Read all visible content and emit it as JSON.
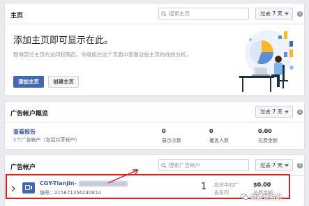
{
  "pages_card": {
    "title": "主页",
    "search_placeholder": "搜索主页",
    "range": "过去 7 天",
    "heading": "添加主页即可显示在此。",
    "description": "取得部分主页的访问权限后，你就能在这个页面中查看这些主页的成效分析。",
    "add_button": "添加主页",
    "create_button": "创建主页"
  },
  "ad_overview": {
    "title": "广告帐户概览",
    "range": "过去 7 天",
    "report_link": "查看报告",
    "account_count": "1个广告帐户（包括共享帐户）",
    "stats": [
      {
        "value": "0",
        "label": "展示次数"
      },
      {
        "value": "0",
        "label": "覆盖人数"
      },
      {
        "value": "0.00",
        "label": "花费金额"
      }
    ]
  },
  "ad_accounts": {
    "title": "广告帐户",
    "search_placeholder": "搜索广告帐户",
    "range": "过去 7 天",
    "account": {
      "name": "CGY-Tianjin-",
      "id_line": "编号：215671356240814",
      "campaign_count": "1",
      "campaign_label_1": "投放中的广",
      "campaign_label_2": "告系列",
      "amount": "$0.00",
      "amount_label": "花费金额"
    }
  },
  "watermark": "丝路贸易说",
  "colors": {
    "brand_blue": "#4267b2",
    "highlight_red": "#e02020",
    "link_blue": "#385898"
  }
}
